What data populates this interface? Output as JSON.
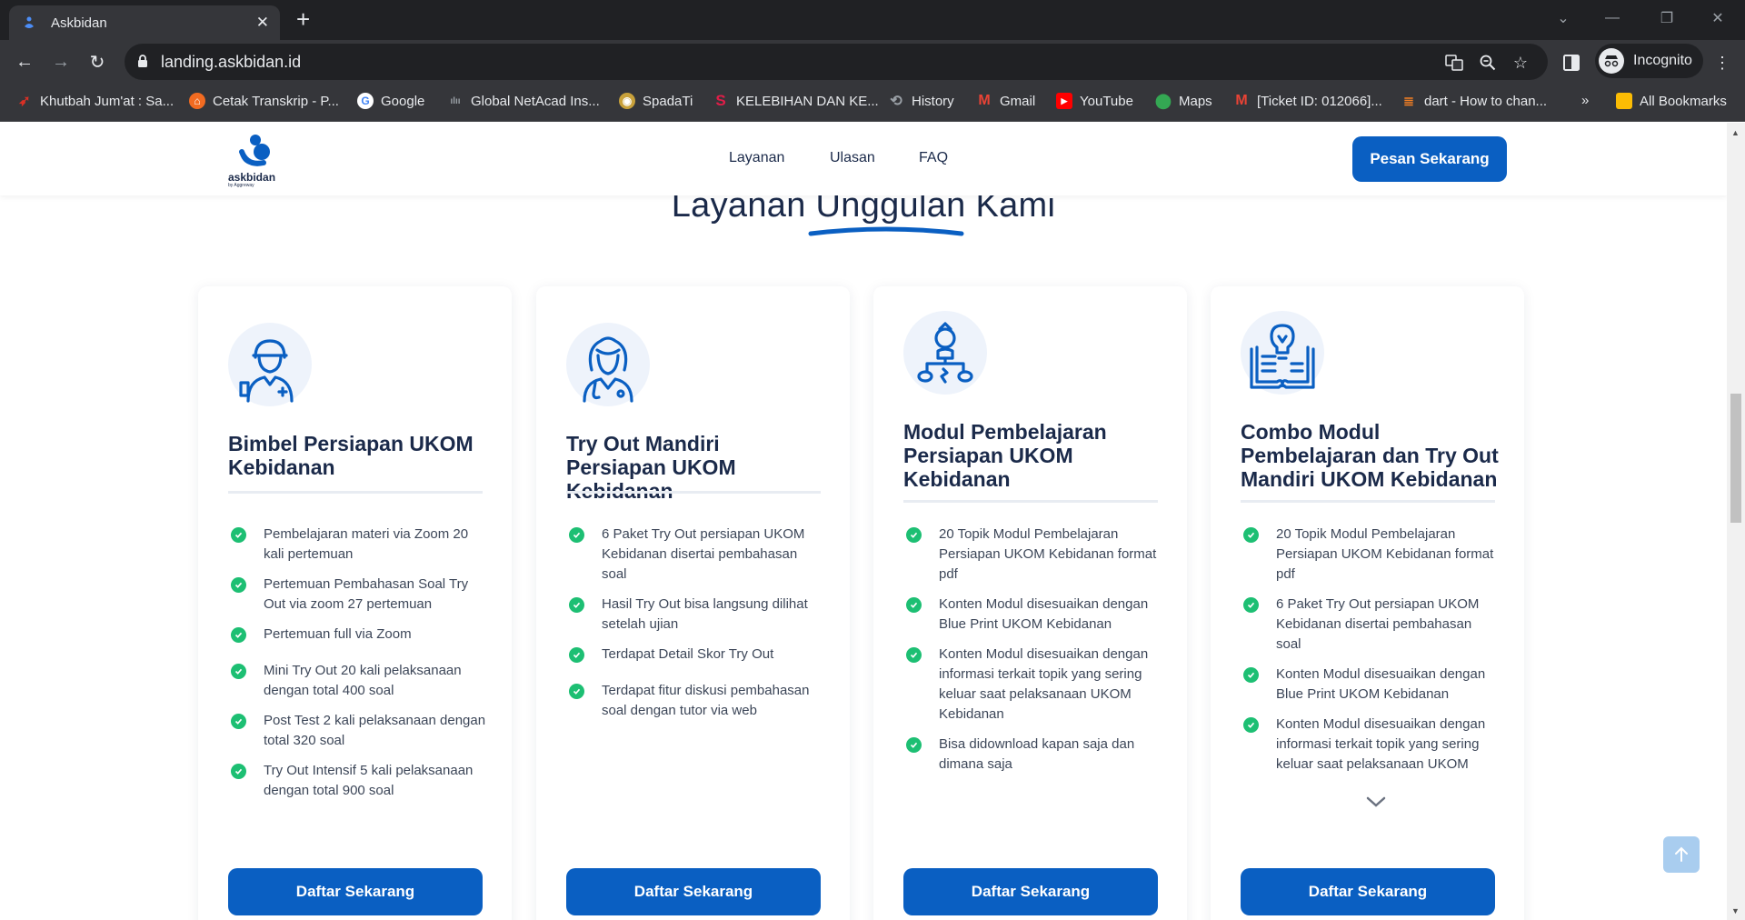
{
  "browser": {
    "tab_title": "Askbidan",
    "url": "landing.askbidan.id",
    "profile_label": "Incognito",
    "bookmarks": [
      {
        "label": "Khutbah Jum'at : Sa...",
        "icon": "red-arrow-icon",
        "color": "#d93025"
      },
      {
        "label": "Cetak Transkrip - P...",
        "icon": "orange-shield-icon",
        "color": "#f26b21"
      },
      {
        "label": "Google",
        "icon": "google-icon",
        "color": "#4285f4"
      },
      {
        "label": "Global NetAcad Ins...",
        "icon": "cisco-icon",
        "color": "#6b7280"
      },
      {
        "label": "SpadaTi",
        "icon": "spadati-icon",
        "color": "#c8a13b"
      },
      {
        "label": "KELEBIHAN DAN KE...",
        "icon": "s-icon",
        "color": "#e11d48"
      },
      {
        "label": "History",
        "icon": "history-icon",
        "color": "#9aa0a6"
      },
      {
        "label": "Gmail",
        "icon": "gmail-icon",
        "color": "#ea4335"
      },
      {
        "label": "YouTube",
        "icon": "youtube-icon",
        "color": "#ff0000"
      },
      {
        "label": "Maps",
        "icon": "maps-icon",
        "color": "#34a853"
      },
      {
        "label": "[Ticket ID: 012066]...",
        "icon": "gmail-icon",
        "color": "#ea4335"
      },
      {
        "label": "dart - How to chan...",
        "icon": "stackoverflow-icon",
        "color": "#f48024"
      }
    ],
    "all_bookmarks_label": "All Bookmarks"
  },
  "site": {
    "logo_text": "askbidan",
    "logo_sub": "by Aggreway",
    "nav": [
      "Layanan",
      "Ulasan",
      "FAQ"
    ],
    "cta_label": "Pesan Sekarang",
    "accent": "#0a5fc2"
  },
  "section": {
    "title_pre": "Layanan",
    "title_highlight": "Unggulan",
    "title_post": "Kami"
  },
  "cards": [
    {
      "title": "Bimbel Persiapan UKOM Kebidanan",
      "icon": "nurse-icon",
      "features": [
        "Pembelajaran materi via Zoom 20 kali pertemuan",
        "Pertemuan Pembahasan Soal Try Out via zoom 27 pertemuan",
        "Pertemuan full via Zoom",
        "Mini Try Out 20 kali pelaksanaan dengan total 400 soal",
        "Post Test 2 kali pelaksanaan dengan total 320 soal",
        "Try Out Intensif 5 kali pelaksanaan dengan total 900 soal"
      ],
      "button": "Daftar Sekarang"
    },
    {
      "title": "Try Out Mandiri Persiapan UKOM Kebidanan",
      "icon": "doctor-woman-icon",
      "features": [
        "6 Paket Try Out persiapan UKOM Kebidanan disertai pembahasan soal",
        "Hasil Try Out bisa langsung dilihat setelah ujian",
        "Terdapat Detail Skor Try Out",
        "Terdapat fitur diskusi pembahasan soal dengan tutor via web"
      ],
      "button": "Daftar Sekarang"
    },
    {
      "title": "Modul Pembelajaran Persiapan UKOM Kebidanan",
      "icon": "learning-structure-icon",
      "features": [
        "20 Topik Modul Pembelajaran Persiapan UKOM Kebidanan format pdf",
        "Konten Modul disesuaikan dengan Blue Print UKOM Kebidanan",
        "Konten Modul disesuaikan dengan informasi terkait topik yang sering keluar saat pelaksanaan UKOM Kebidanan",
        "Bisa didownload kapan saja dan dimana saja"
      ],
      "button": "Daftar Sekarang"
    },
    {
      "title": "Combo Modul Pembelajaran dan Try Out Mandiri UKOM Kebidanan",
      "icon": "book-idea-icon",
      "features": [
        "20 Topik Modul Pembelajaran Persiapan UKOM Kebidanan format pdf",
        "6 Paket Try Out persiapan UKOM Kebidanan disertai pembahasan soal",
        "Konten Modul disesuaikan dengan Blue Print UKOM Kebidanan",
        "Konten Modul disesuaikan dengan informasi terkait topik yang sering keluar saat pelaksanaan UKOM"
      ],
      "button": "Daftar Sekarang"
    }
  ]
}
